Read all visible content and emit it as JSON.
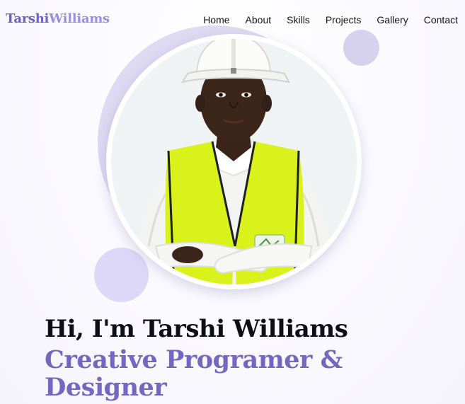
{
  "header": {
    "logo_first": "Tarshi",
    "logo_second": "Williams",
    "nav": [
      "Home",
      "About",
      "Skills",
      "Projects",
      "Gallery",
      "Contact"
    ]
  },
  "hero": {
    "greeting": "Hi, I'm Tarshi Williams",
    "role_line1": "Creative Programer &",
    "role_line2": "Designer",
    "photo_icon": "portrait-photo"
  },
  "colors": {
    "brand_primary": "#6f5fc4",
    "brand_secondary": "#9a8ee0",
    "role_text": "#7566c2",
    "heading_text": "#0e0e16",
    "decor_circle": "#dedaf3",
    "vest_yellow": "#d9f21b"
  }
}
